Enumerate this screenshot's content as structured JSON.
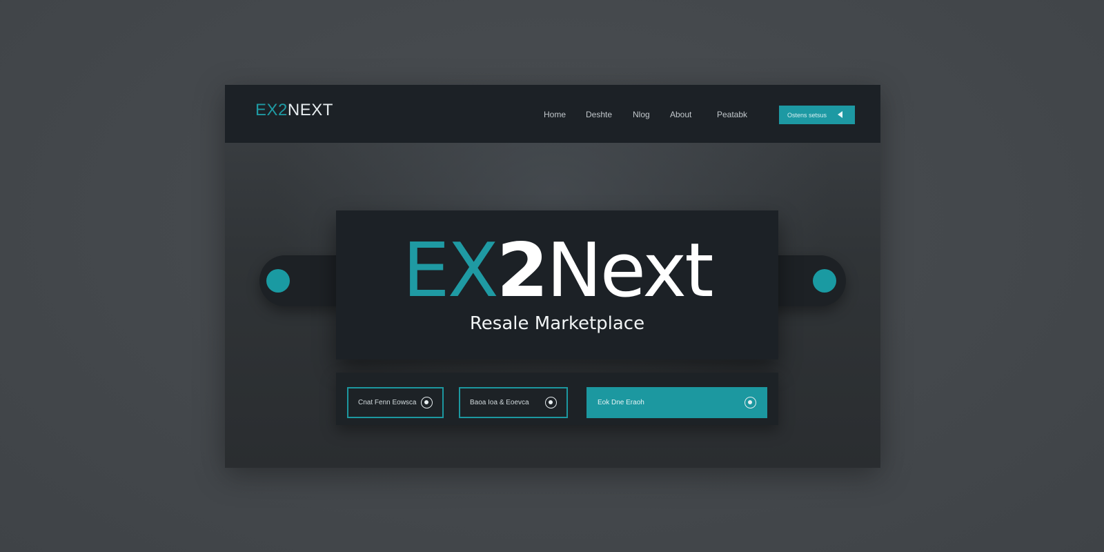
{
  "header": {
    "brand_part1": "EX2",
    "brand_part2": "NEXT",
    "nav": [
      "Home",
      "Deshte",
      "Nlog",
      "About",
      "Peatabk"
    ],
    "cta_label": "Ostens setsus"
  },
  "hero": {
    "title_part1": "EX",
    "title_part2": "2",
    "title_part3": "Next",
    "subtitle": "Resale Marketplace"
  },
  "actions": [
    {
      "label": "Cnat Fenn Eowsca"
    },
    {
      "label": "Baoa Ioa & Eoevca"
    },
    {
      "label": "Eok Dne Eraoh"
    }
  ],
  "colors": {
    "accent": "#1d99a3",
    "header_bg": "#1c2126",
    "page_bg": "#464a4e"
  },
  "icons": {
    "cta": "chevron-left-icon",
    "carousel": "carousel-dot-icon",
    "action": "radio-target-icon"
  }
}
